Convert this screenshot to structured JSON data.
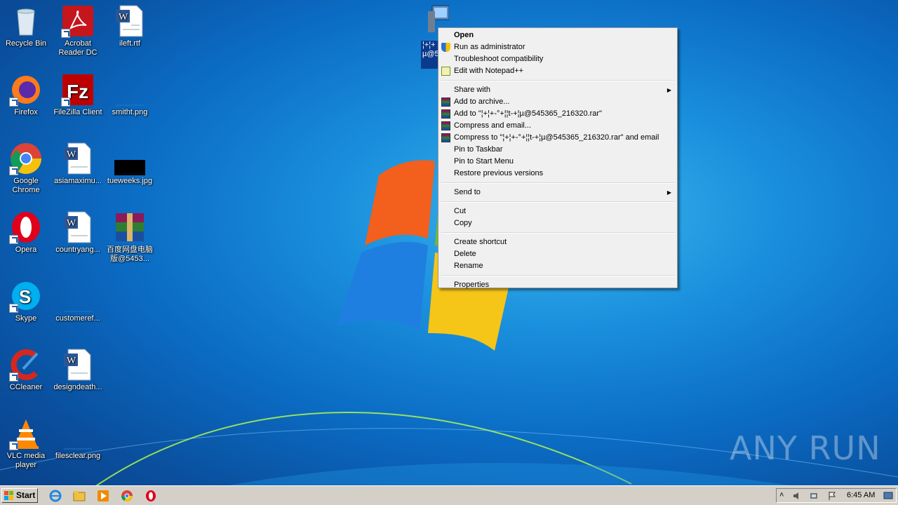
{
  "desktop": {
    "icons": [
      {
        "label": "Recycle Bin"
      },
      {
        "label": "Acrobat Reader DC"
      },
      {
        "label": "ileft.rtf"
      },
      {
        "label": "Firefox"
      },
      {
        "label": "FileZilla Client"
      },
      {
        "label": "smitht.png"
      },
      {
        "label": "Google Chrome"
      },
      {
        "label": "asiamaximu..."
      },
      {
        "label": "tueweeks.jpg"
      },
      {
        "label": "Opera"
      },
      {
        "label": "countryang..."
      },
      {
        "label": "百度网盘电脑版@5453..."
      },
      {
        "label": "Skype"
      },
      {
        "label": "customeref..."
      },
      {
        "label": "CCleaner"
      },
      {
        "label": "designdeath..."
      },
      {
        "label": "VLC media player"
      },
      {
        "label": "filesclear.png"
      }
    ],
    "selected_icon_label": "¦+¦+ µ@5 63"
  },
  "context_menu": {
    "items": [
      {
        "label": "Open"
      },
      {
        "label": "Run as administrator"
      },
      {
        "label": "Troubleshoot compatibility"
      },
      {
        "label": "Edit with Notepad++"
      },
      {
        "label": "Share with"
      },
      {
        "label": "Add to archive..."
      },
      {
        "label": "Add to \"¦+¦+-°+¦¦t-+¦µ@545365_216320.rar\""
      },
      {
        "label": "Compress and email..."
      },
      {
        "label": "Compress to \"¦+¦+-°+¦¦t-+¦µ@545365_216320.rar\" and email"
      },
      {
        "label": "Pin to Taskbar"
      },
      {
        "label": "Pin to Start Menu"
      },
      {
        "label": "Restore previous versions"
      },
      {
        "label": "Send to"
      },
      {
        "label": "Cut"
      },
      {
        "label": "Copy"
      },
      {
        "label": "Create shortcut"
      },
      {
        "label": "Delete"
      },
      {
        "label": "Rename"
      },
      {
        "label": "Properties"
      }
    ]
  },
  "taskbar": {
    "start_label": "Start",
    "clock": "6:45 AM"
  },
  "watermark": "ANY RUN"
}
